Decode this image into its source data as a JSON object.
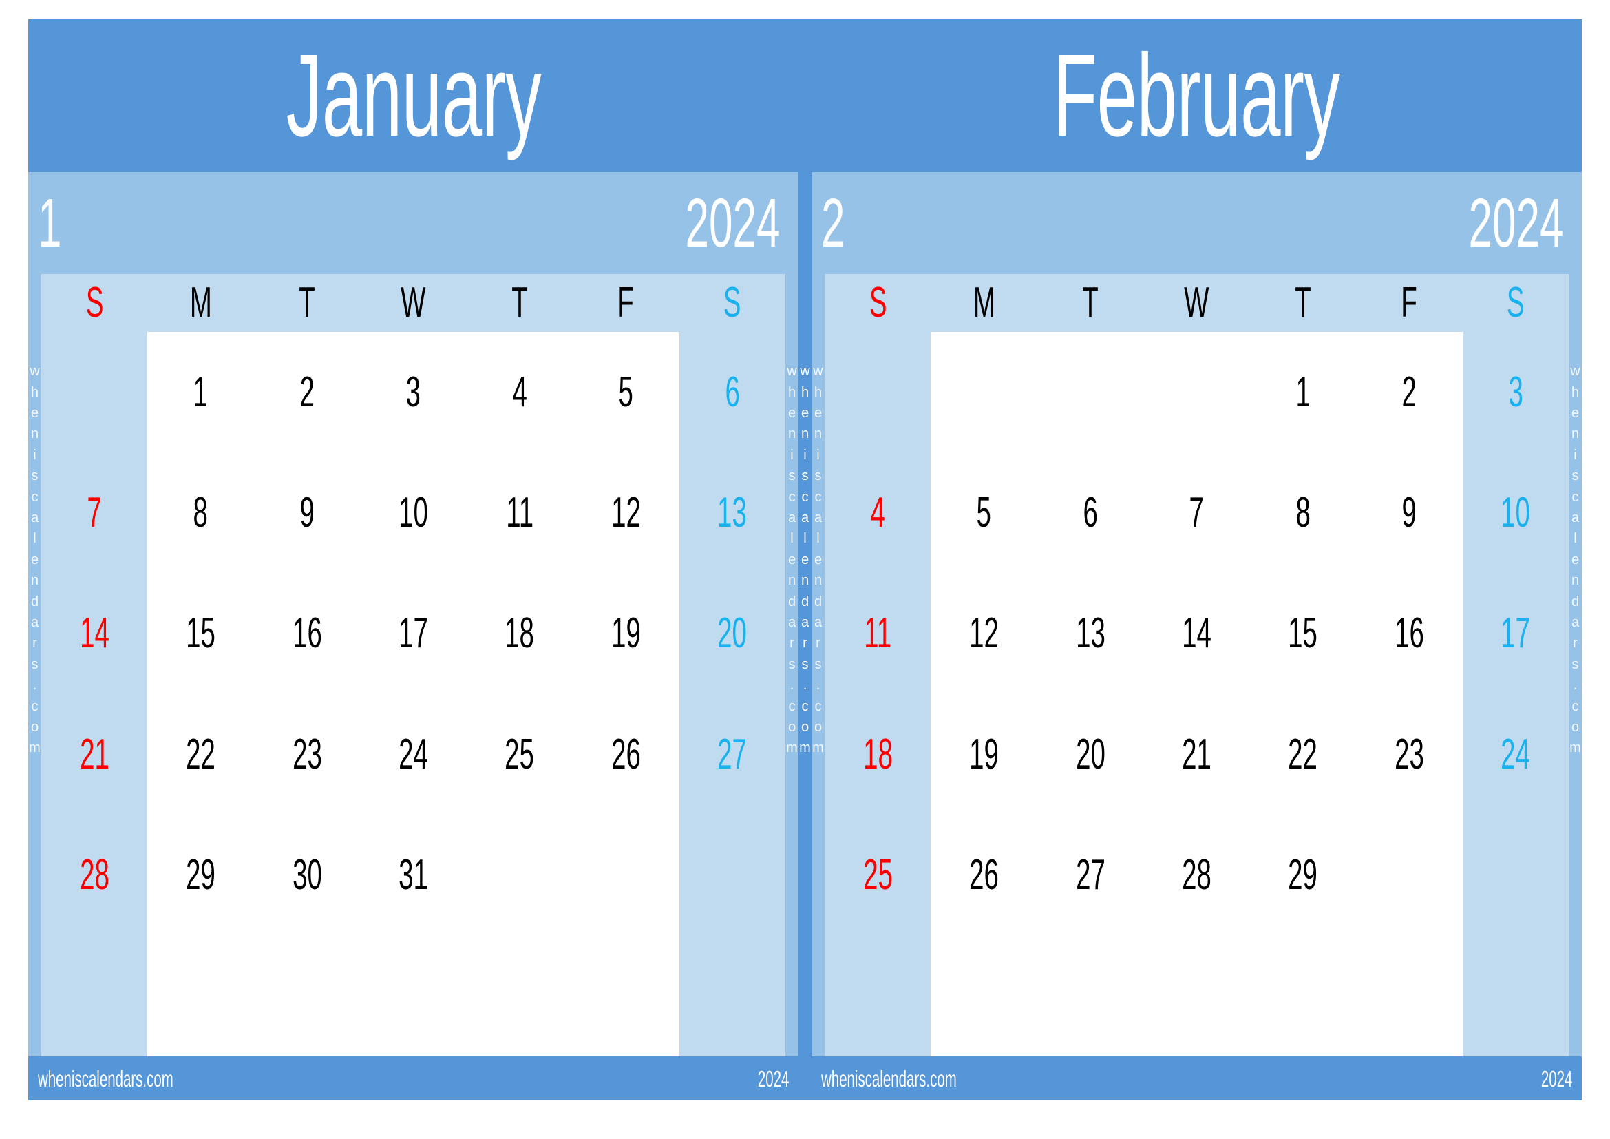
{
  "colors": {
    "header_blue": "#5596d8",
    "year_band_blue": "#97c2e8",
    "grid_blue": "#c0daf0",
    "cell_white": "#ffffff",
    "sunday_red": "#fc0000",
    "saturday_cyan": "#19b2ef",
    "weekday_black": "#000000",
    "text_white": "#ffffff"
  },
  "watermark": {
    "text": "wheniscalendars.com",
    "chars": [
      "w",
      "h",
      "e",
      "n",
      "i",
      "s",
      "c",
      "a",
      "l",
      "e",
      "n",
      "d",
      "a",
      "r",
      "s",
      ".",
      "c",
      "o",
      "m"
    ]
  },
  "weekday_headers": [
    "S",
    "M",
    "T",
    "W",
    "T",
    "F",
    "S"
  ],
  "months": [
    {
      "name": "January",
      "number": "1",
      "year": "2024",
      "footer_site": "wheniscalendars.com",
      "footer_year": "2024",
      "first_weekday_index": 1,
      "num_days": 31,
      "weeks": [
        [
          "",
          "1",
          "2",
          "3",
          "4",
          "5",
          "6"
        ],
        [
          "7",
          "8",
          "9",
          "10",
          "11",
          "12",
          "13"
        ],
        [
          "14",
          "15",
          "16",
          "17",
          "18",
          "19",
          "20"
        ],
        [
          "21",
          "22",
          "23",
          "24",
          "25",
          "26",
          "27"
        ],
        [
          "28",
          "29",
          "30",
          "31",
          "",
          "",
          ""
        ],
        [
          "",
          "",
          "",
          "",
          "",
          "",
          ""
        ]
      ]
    },
    {
      "name": "February",
      "number": "2",
      "year": "2024",
      "footer_site": "wheniscalendars.com",
      "footer_year": "2024",
      "first_weekday_index": 4,
      "num_days": 29,
      "weeks": [
        [
          "",
          "",
          "",
          "",
          "1",
          "2",
          "3"
        ],
        [
          "4",
          "5",
          "6",
          "7",
          "8",
          "9",
          "10"
        ],
        [
          "11",
          "12",
          "13",
          "14",
          "15",
          "16",
          "17"
        ],
        [
          "18",
          "19",
          "20",
          "21",
          "22",
          "23",
          "24"
        ],
        [
          "25",
          "26",
          "27",
          "28",
          "29",
          "",
          ""
        ],
        [
          "",
          "",
          "",
          "",
          "",
          "",
          ""
        ]
      ]
    }
  ]
}
